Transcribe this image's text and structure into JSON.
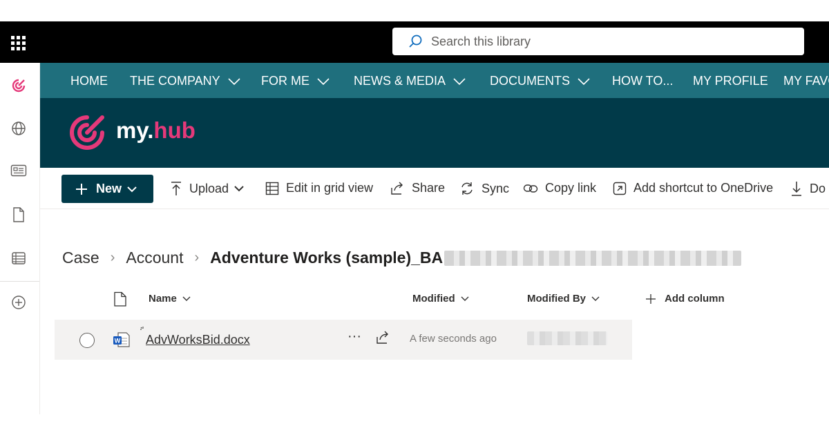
{
  "topbar": {
    "search_placeholder": "Search this library",
    "icons": [
      "app-launcher-icon",
      "search-icon"
    ]
  },
  "left_rail": {
    "icons": [
      "myhub-icon",
      "globe-icon",
      "news-icon",
      "document-icon",
      "list-icon",
      "add-icon"
    ]
  },
  "nav": {
    "items": [
      {
        "label": "HOME",
        "has_dropdown": false
      },
      {
        "label": "THE COMPANY",
        "has_dropdown": true
      },
      {
        "label": "FOR ME",
        "has_dropdown": true
      },
      {
        "label": "NEWS & MEDIA",
        "has_dropdown": true
      },
      {
        "label": "DOCUMENTS",
        "has_dropdown": true
      },
      {
        "label": "HOW TO...",
        "has_dropdown": false
      },
      {
        "label": "MY PROFILE",
        "has_dropdown": false
      },
      {
        "label": "MY FAVO",
        "has_dropdown": false
      }
    ]
  },
  "header": {
    "logo_prefix": "my.",
    "logo_suffix": "hub",
    "accent_color": "#e5397a",
    "header_color": "#013a49",
    "nav_color": "#1f6f7d"
  },
  "commandbar": {
    "new_label": "New",
    "upload_label": "Upload",
    "grid_label": "Edit in grid view",
    "share_label": "Share",
    "sync_label": "Sync",
    "copylink_label": "Copy link",
    "shortcut_label": "Add shortcut to OneDrive",
    "download_label": "Do"
  },
  "breadcrumb": {
    "items": [
      "Case",
      "Account"
    ],
    "current": "Adventure Works (sample)_BA"
  },
  "columns": {
    "name": "Name",
    "modified": "Modified",
    "modified_by": "Modified By",
    "add_column": "Add column"
  },
  "files": [
    {
      "name": "AdvWorksBid.docx",
      "modified": "A few seconds ago",
      "type_icon": "word-file-icon"
    }
  ]
}
